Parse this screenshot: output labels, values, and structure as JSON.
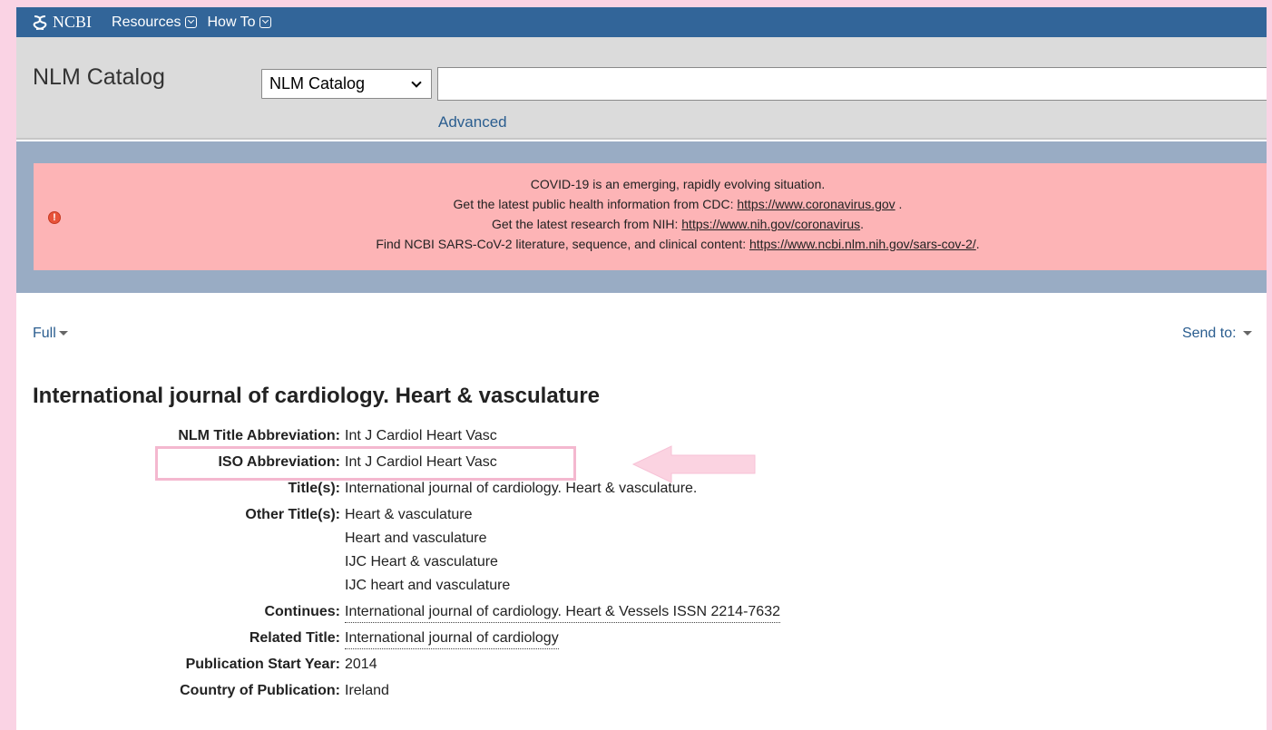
{
  "topbar": {
    "logo_text": "NCBI",
    "menus": [
      {
        "label": "Resources"
      },
      {
        "label": "How To"
      }
    ]
  },
  "search": {
    "db_title": "NLM Catalog",
    "db_selected": "NLM Catalog",
    "query_value": "",
    "advanced_label": "Advanced"
  },
  "alert": {
    "lines": [
      {
        "text": "COVID-19 is an emerging, rapidly evolving situation.",
        "link": ""
      },
      {
        "text": "Get the latest public health information from CDC: ",
        "link": "https://www.coronavirus.gov",
        "after": " ."
      },
      {
        "text": "Get the latest research from NIH: ",
        "link": "https://www.nih.gov/coronavirus",
        "after": "."
      },
      {
        "text": "Find NCBI SARS-CoV-2 literature, sequence, and clinical content: ",
        "link": "https://www.ncbi.nlm.nih.gov/sars-cov-2/",
        "after": "."
      }
    ]
  },
  "controls": {
    "format_label": "Full",
    "send_label": "Send to:"
  },
  "record": {
    "title": "International journal of cardiology. Heart & vasculature",
    "fields": [
      {
        "label": "NLM Title Abbreviation:",
        "values": [
          "Int J Cardiol Heart Vasc"
        ],
        "linked": false
      },
      {
        "label": "ISO Abbreviation:",
        "values": [
          "Int J Cardiol Heart Vasc"
        ],
        "linked": false
      },
      {
        "label": "Title(s):",
        "values": [
          "International journal of cardiology. Heart & vasculature."
        ],
        "linked": false
      },
      {
        "label": "Other Title(s):",
        "values": [
          "Heart & vasculature",
          "Heart and vasculature",
          "IJC Heart & vasculature",
          "IJC heart and vasculature"
        ],
        "linked": false
      },
      {
        "label": "Continues:",
        "values": [
          "International journal of cardiology. Heart & Vessels ISSN 2214-7632"
        ],
        "linked": true
      },
      {
        "label": "Related Title:",
        "values": [
          "International journal of cardiology"
        ],
        "linked": true
      },
      {
        "label": "Publication Start Year:",
        "values": [
          "2014"
        ],
        "linked": false
      },
      {
        "label": "Country of Publication:",
        "values": [
          "Ireland"
        ],
        "linked": false
      }
    ]
  },
  "colors": {
    "page_border": "#fad3e4",
    "ncbi_bar": "#326599",
    "alert_band": "#99acc4",
    "alert_box": "#fdb4b6",
    "link": "#2a5d8f",
    "highlight": "#f4b8cf"
  },
  "icons": [
    "ncbi-logo-icon",
    "alert-exclamation-icon",
    "dropdown-caret-icon",
    "pink-arrow-icon"
  ]
}
